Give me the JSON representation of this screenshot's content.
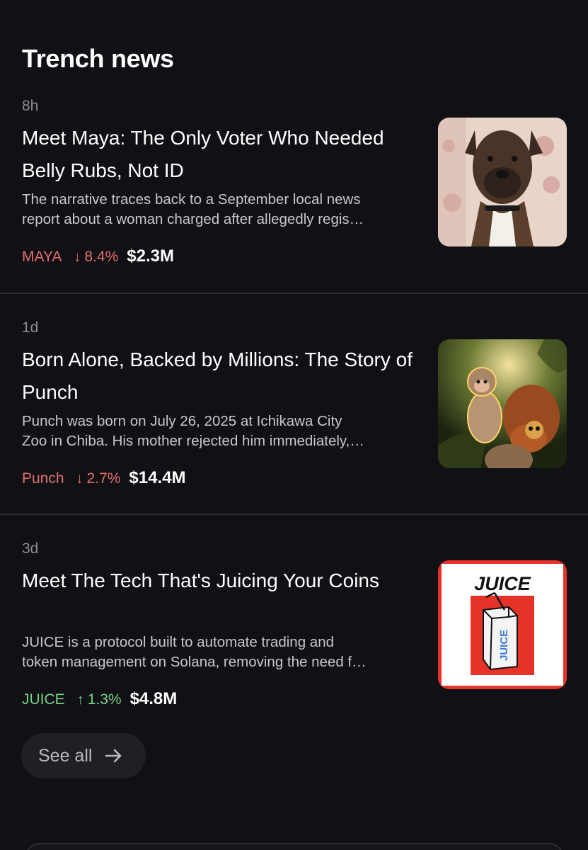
{
  "section": {
    "title": "Trench news"
  },
  "items": [
    {
      "age": "8h",
      "title": "Meet Maya: The Only Voter Who Needed Belly Rubs, Not ID",
      "summary_lines": [
        "The narrative traces back to a September local news",
        "report about a woman charged after allegedly regis…"
      ],
      "ticker": "MAYA",
      "direction": "down",
      "change": "8.4%",
      "market_cap": "$2.3M",
      "thumbnail_icon": "boxer-dog-photo"
    },
    {
      "age": "1d",
      "title": "Born Alone, Backed by Millions: The Story of Punch",
      "summary_lines": [
        "Punch was born on July 26, 2025 at Ichikawa City",
        "Zoo in Chiba. His mother rejected him immediately,…"
      ],
      "ticker": "Punch",
      "direction": "down",
      "change": "2.7%",
      "market_cap": "$14.4M",
      "thumbnail_icon": "baby-monkey-plush-photo"
    },
    {
      "age": "3d",
      "title": "Meet The Tech That's Juicing Your Coins",
      "summary_lines": [
        "JUICE is a protocol built to automate trading and",
        "token management on Solana, removing the need f…"
      ],
      "ticker": "JUICE",
      "direction": "up",
      "change": "1.3%",
      "market_cap": "$4.8M",
      "thumbnail_icon": "juice-box-logo",
      "thumbnail_text": "JUICE",
      "thumbnail_box_text": "JUICE"
    }
  ],
  "see_all": {
    "label": "See all",
    "icon": "arrow-right-icon"
  },
  "colors": {
    "background": "#101015",
    "negative": "#e2706b",
    "positive": "#78d28a",
    "divider": "#2a2a30",
    "juice_red": "#e5332a"
  }
}
